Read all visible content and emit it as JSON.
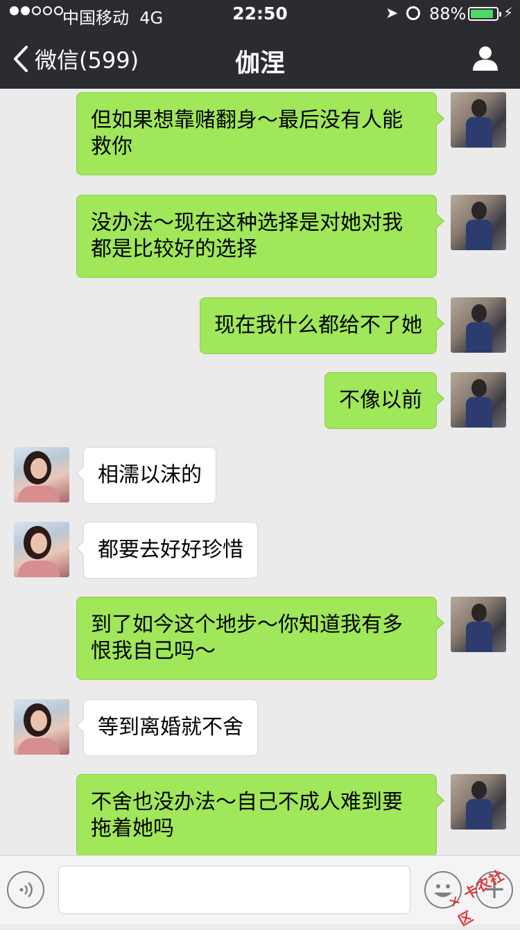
{
  "status_bar": {
    "carrier": "中国移动",
    "network": "4G",
    "time": "22:50",
    "battery_percent": "88%",
    "battery_level": 0.88,
    "icons": [
      "signal-dots-icon",
      "location-arrow-icon",
      "alarm-icon",
      "battery-icon",
      "charging-bolt-icon"
    ]
  },
  "nav": {
    "back_label": "微信(599)",
    "title": "伽涅",
    "icons": [
      "back-chevron-icon",
      "contact-profile-icon"
    ]
  },
  "messages": [
    {
      "from": "me",
      "text": "但如果想靠赌翻身～最后没有人能救你"
    },
    {
      "from": "me",
      "text": "没办法～现在这种选择是对她对我都是比较好的选择"
    },
    {
      "from": "me",
      "text": "现在我什么都给不了她"
    },
    {
      "from": "me",
      "text": "不像以前"
    },
    {
      "from": "them",
      "text": "相濡以沫的"
    },
    {
      "from": "them",
      "text": "都要去好好珍惜"
    },
    {
      "from": "me",
      "text": "到了如今这个地步～你知道我有多恨我自己吗～"
    },
    {
      "from": "them",
      "text": "等到离婚就不舍"
    },
    {
      "from": "me",
      "text": "不舍也没办法～自己不成人难到要拖着她吗"
    }
  ],
  "input_bar": {
    "value": "",
    "icons": [
      "voice-icon",
      "emoji-icon",
      "plus-icon"
    ]
  },
  "watermark": "卡农社区",
  "colors": {
    "nav_bg": "#2b2c30",
    "chat_bg": "#ebebeb",
    "my_bubble": "#a0e759",
    "their_bubble": "#ffffff",
    "battery_fill": "#4cd964"
  }
}
